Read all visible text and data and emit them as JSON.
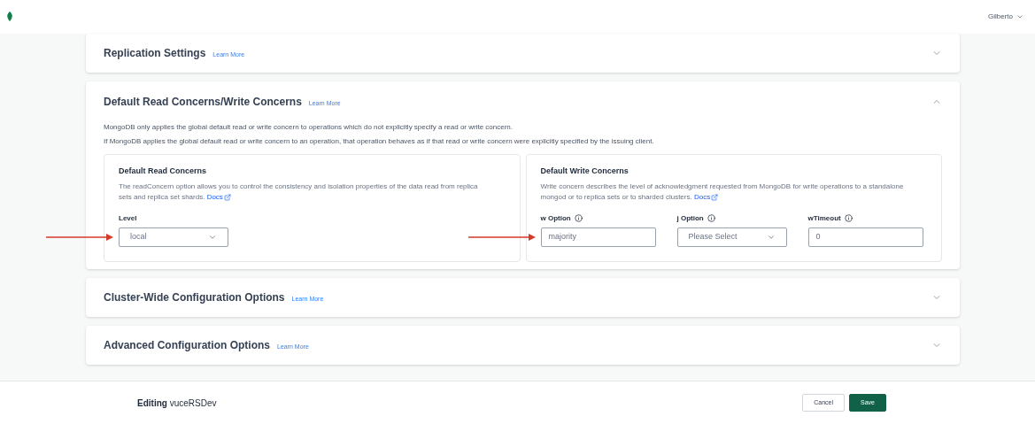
{
  "header": {
    "user": "Gilberto"
  },
  "sections": [
    {
      "title": "Replication Settings",
      "link": "Learn More",
      "expanded": false
    },
    {
      "title": "Default Read Concerns/Write Concerns",
      "link": "Learn More",
      "expanded": true,
      "paragraphs": [
        "MongoDB only applies the global default read or write concern to operations which do not explicitly specify a read or write concern.",
        "If MongoDB applies the global default read or write concern to an operation, that operation behaves as if that read or write concern were explicitly specified by the issuing client."
      ],
      "panels": [
        {
          "title": "Default Read Concerns",
          "text": "The readConcern option allows you to control the consistency and isolation properties of the data read from replica sets and replica set shards.",
          "link": "Docs",
          "fields": [
            {
              "kind": "select",
              "label": "Level",
              "value": "local",
              "info": false,
              "arrow": true
            }
          ]
        },
        {
          "title": "Default Write Concerns",
          "text": "Write concern describes the level of acknowledgment requested from MongoDB for write operations to a standalone mongod or to replica sets or to sharded clusters.",
          "link": "Docs",
          "fields": [
            {
              "kind": "input",
              "label": "w Option",
              "value": "majority",
              "info": true,
              "arrow": true
            },
            {
              "kind": "select",
              "label": "j Option",
              "value": "Please Select",
              "info": true,
              "arrow": false
            },
            {
              "kind": "input",
              "label": "wTimeout",
              "value": "0",
              "info": true,
              "arrow": false
            }
          ]
        }
      ]
    },
    {
      "title": "Cluster-Wide Configuration Options",
      "link": "Learn More",
      "expanded": false
    },
    {
      "title": "Advanced Configuration Options",
      "link": "Learn More",
      "expanded": false
    }
  ],
  "footer": {
    "label": "Editing",
    "name": "vuceRSDev",
    "buttons": [
      {
        "label": "Cancel",
        "kind": "secondary"
      },
      {
        "label": "Save",
        "kind": "primary"
      }
    ]
  }
}
